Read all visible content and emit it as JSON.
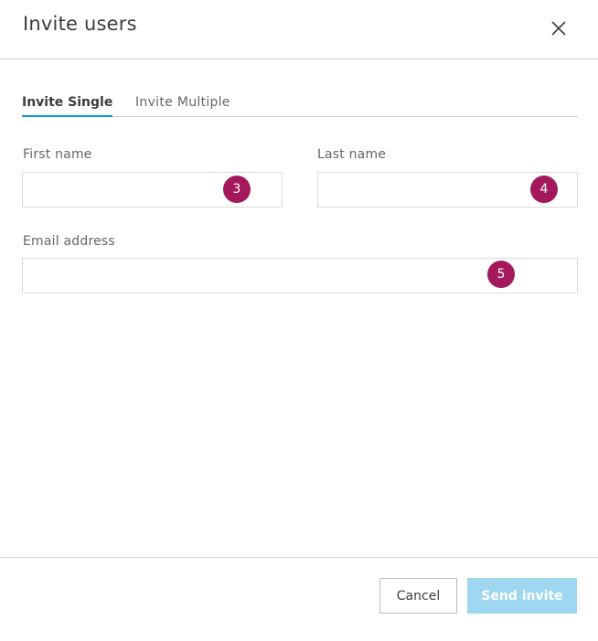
{
  "dialog": {
    "title": "Invite users",
    "close_icon": "close-icon"
  },
  "tabs": [
    {
      "label": "Invite Single",
      "active": true
    },
    {
      "label": "Invite Multiple",
      "active": false
    }
  ],
  "form": {
    "first_name": {
      "label": "First name",
      "value": "",
      "badge": "3"
    },
    "last_name": {
      "label": "Last name",
      "value": "",
      "badge": "4"
    },
    "email": {
      "label": "Email address",
      "value": "",
      "badge": "5"
    }
  },
  "footer": {
    "cancel_label": "Cancel",
    "send_label": "Send invite"
  },
  "colors": {
    "accent": "#0696d7",
    "badge": "#a3195b",
    "send_disabled": "#9fd7f0"
  }
}
